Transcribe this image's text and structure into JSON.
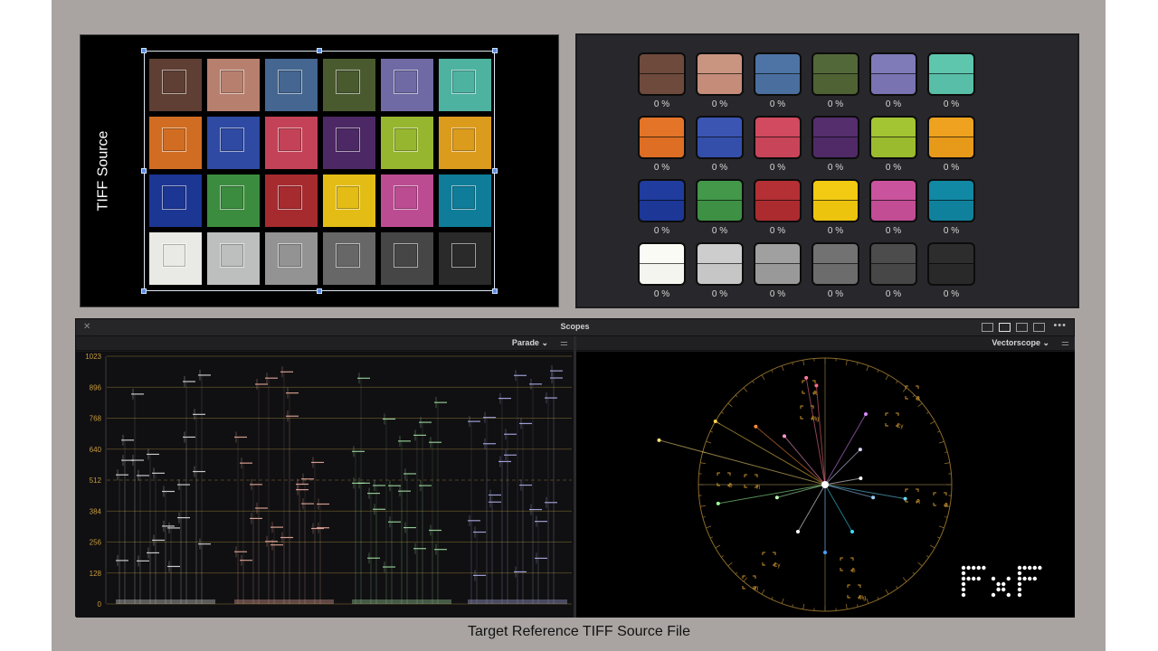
{
  "source_panel": {
    "label": "TIFF Source",
    "swatches": [
      "#5f3f33",
      "#b7806e",
      "#446690",
      "#4a5a2f",
      "#6f6aa4",
      "#4eb2a0",
      "#d16d22",
      "#2f4aa3",
      "#c44257",
      "#4c2864",
      "#97b62f",
      "#db9b1c",
      "#1c3694",
      "#3c8c3f",
      "#a62b2f",
      "#e3bd15",
      "#bc4c92",
      "#0f7d99",
      "#e9eae5",
      "#bdbebe",
      "#939393",
      "#676767",
      "#464646",
      "#2a2a2a"
    ]
  },
  "swatch_panel": {
    "swatches": [
      {
        "top": "#6e4a3d",
        "bottom": "#6e4a3d",
        "pct": "0 %"
      },
      {
        "top": "#c99480",
        "bottom": "#c48c79",
        "pct": "0 %"
      },
      {
        "top": "#4d74a5",
        "bottom": "#4a6f9e",
        "pct": "0 %"
      },
      {
        "top": "#536838",
        "bottom": "#4f6234",
        "pct": "0 %"
      },
      {
        "top": "#7f7ab8",
        "bottom": "#7973b1",
        "pct": "0 %"
      },
      {
        "top": "#5fc6ae",
        "bottom": "#58bea7",
        "pct": "0 %"
      },
      {
        "top": "#e37428",
        "bottom": "#dd6e23",
        "pct": "0 %"
      },
      {
        "top": "#3a55b2",
        "bottom": "#344faa",
        "pct": "0 %"
      },
      {
        "top": "#d14a5f",
        "bottom": "#c84459",
        "pct": "0 %"
      },
      {
        "top": "#552e6e",
        "bottom": "#4f2a67",
        "pct": "0 %"
      },
      {
        "top": "#a3c433",
        "bottom": "#9bbb2e",
        "pct": "0 %"
      },
      {
        "top": "#eea21f",
        "bottom": "#e79a1a",
        "pct": "0 %"
      },
      {
        "top": "#1f3c9e",
        "bottom": "#1c3795",
        "pct": "0 %"
      },
      {
        "top": "#43984a",
        "bottom": "#3e9044",
        "pct": "0 %"
      },
      {
        "top": "#b43034",
        "bottom": "#ac2b2f",
        "pct": "0 %"
      },
      {
        "top": "#f2cb12",
        "bottom": "#ecc40e",
        "pct": "0 %"
      },
      {
        "top": "#ca539d",
        "bottom": "#c24d95",
        "pct": "0 %"
      },
      {
        "top": "#1188a4",
        "bottom": "#0f819c",
        "pct": "0 %"
      },
      {
        "top": "#fbfbf6",
        "bottom": "#f5f5ef",
        "pct": "0 %"
      },
      {
        "top": "#cdcdcd",
        "bottom": "#c6c6c6",
        "pct": "0 %"
      },
      {
        "top": "#a0a0a0",
        "bottom": "#999999",
        "pct": "0 %"
      },
      {
        "top": "#727272",
        "bottom": "#6c6c6c",
        "pct": "0 %"
      },
      {
        "top": "#4c4c4c",
        "bottom": "#474747",
        "pct": "0 %"
      },
      {
        "top": "#2d2d2d",
        "bottom": "#292929",
        "pct": "0 %"
      }
    ]
  },
  "scopes": {
    "title": "Scopes",
    "close_icon": "close-icon",
    "left_scope": "Parade",
    "right_scope": "Vectorscope",
    "parade_axis": [
      "1023",
      "896",
      "768",
      "640",
      "512",
      "384",
      "256",
      "128",
      "0"
    ],
    "vector_targets": [
      "R",
      "Mg",
      "B",
      "Cy",
      "G",
      "Yl",
      "R",
      "B",
      "Cy",
      "G",
      "Mg",
      "Yl"
    ]
  },
  "caption": "Target Reference TIFF Source File",
  "logo_text": "FxF"
}
